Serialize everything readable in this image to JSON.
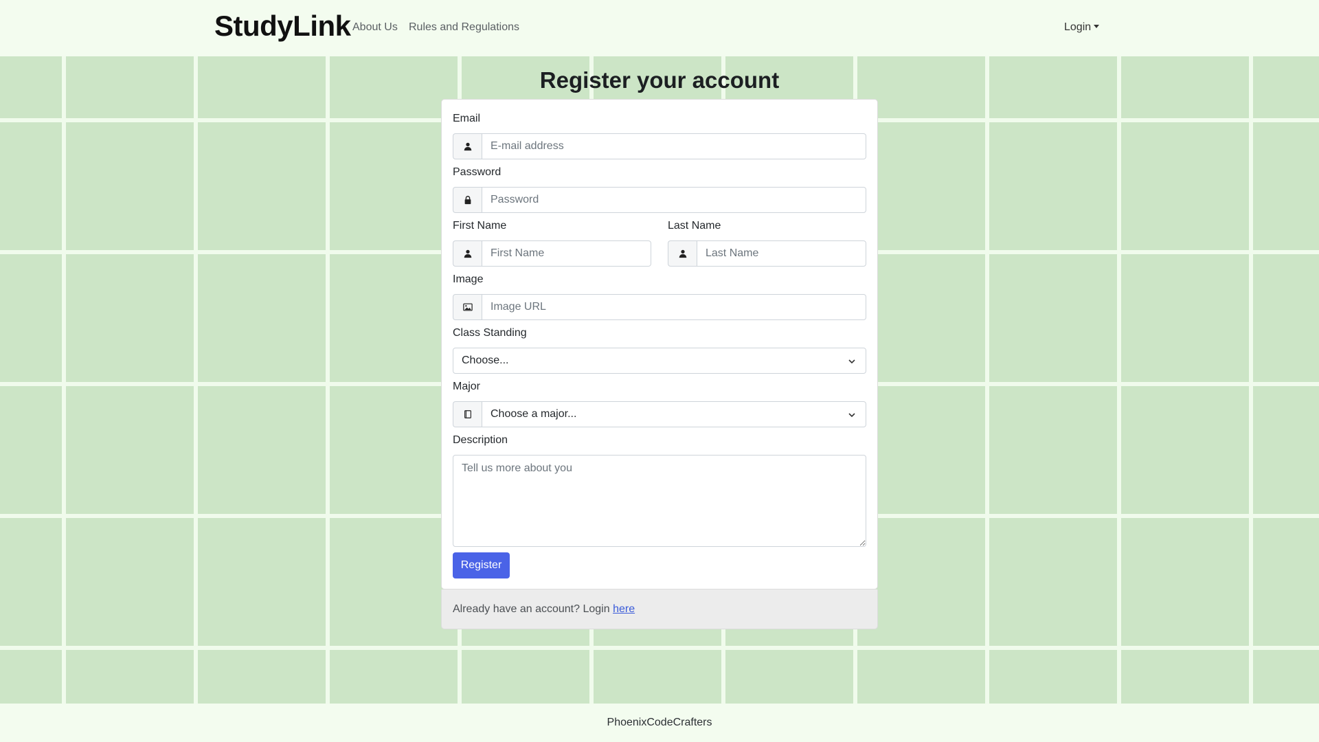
{
  "navbar": {
    "brand": "StudyLink",
    "links": [
      "About Us",
      "Rules and Regulations"
    ],
    "login_label": "Login"
  },
  "page": {
    "title": "Register your account"
  },
  "form": {
    "email": {
      "label": "Email",
      "placeholder": "E-mail address",
      "icon": "user-icon"
    },
    "password": {
      "label": "Password",
      "placeholder": "Password",
      "icon": "lock-icon"
    },
    "first_name": {
      "label": "First Name",
      "placeholder": "First Name",
      "icon": "user-icon"
    },
    "last_name": {
      "label": "Last Name",
      "placeholder": "Last Name",
      "icon": "user-icon"
    },
    "image": {
      "label": "Image",
      "placeholder": "Image URL",
      "icon": "image-icon"
    },
    "class_standing": {
      "label": "Class Standing",
      "selected": "Choose..."
    },
    "major": {
      "label": "Major",
      "selected": "Choose a major...",
      "icon": "book-icon"
    },
    "description": {
      "label": "Description",
      "placeholder": "Tell us more about you"
    },
    "submit_label": "Register"
  },
  "card_footer": {
    "text": "Already have an account? Login ",
    "link": "here"
  },
  "footer": {
    "text": "PhoenixCodeCrafters"
  },
  "colors": {
    "accent": "#4a63e7",
    "background": "#cce5c6",
    "navbar": "#f3fcef"
  }
}
